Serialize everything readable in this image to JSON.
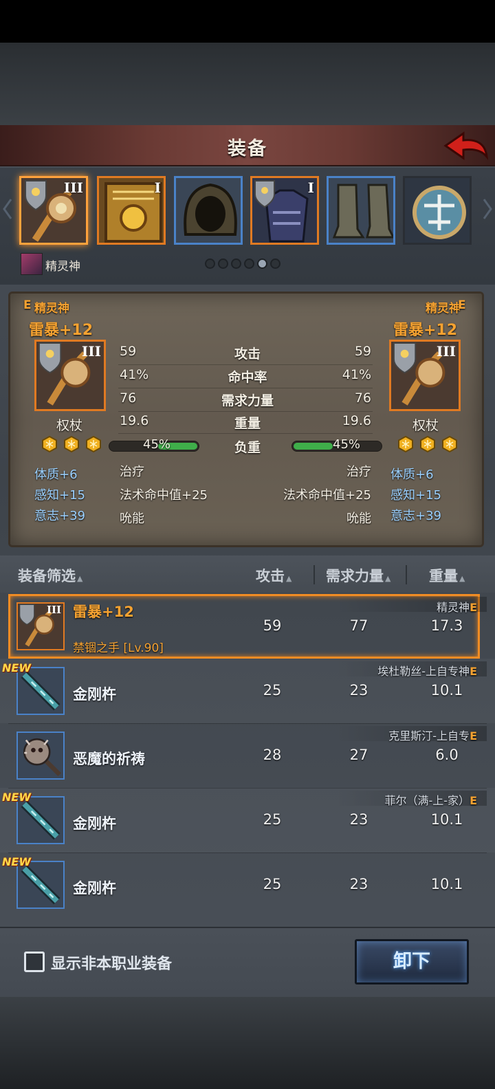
{
  "header": {
    "title": "装备"
  },
  "slots": [
    {
      "tier": "III",
      "border": "selected",
      "icon": "scepter-icon"
    },
    {
      "tier": "I",
      "border": "orange",
      "icon": "tome-icon"
    },
    {
      "tier": "",
      "border": "blue",
      "icon": "hood-icon"
    },
    {
      "tier": "I",
      "border": "orange",
      "icon": "armor-icon"
    },
    {
      "tier": "",
      "border": "blue",
      "icon": "boots-icon"
    },
    {
      "tier": "",
      "border": "plain",
      "icon": "amulet-icon"
    }
  ],
  "character": {
    "name": "精灵神"
  },
  "pager": {
    "count": 6,
    "active": 5
  },
  "compare": {
    "left": {
      "owner": "精灵神",
      "grade": "E",
      "name": "雷暴+12",
      "tier": "III",
      "type": "权杖",
      "load_pct": "45%",
      "load_value": 0.45,
      "attrs": [
        "体质+6",
        "感知+15",
        "意志+39"
      ],
      "effects": [
        "治疗",
        "法术命中值+25",
        "吮能"
      ]
    },
    "right": {
      "owner": "精灵神",
      "grade": "E",
      "name": "雷暴+12",
      "tier": "III",
      "type": "权杖",
      "load_pct": "45%",
      "load_value": 0.45,
      "attrs": [
        "体质+6",
        "感知+15",
        "意志+39"
      ],
      "effects": [
        "治疗",
        "法术命中值+25",
        "吮能"
      ]
    },
    "stats": [
      {
        "label": "攻击",
        "left": "59",
        "right": "59"
      },
      {
        "label": "命中率",
        "left": "41%",
        "right": "41%"
      },
      {
        "label": "需求力量",
        "left": "76",
        "right": "76"
      },
      {
        "label": "重量",
        "left": "19.6",
        "right": "19.6"
      }
    ],
    "load_label": "负重"
  },
  "list": {
    "headers": {
      "filter": "装备筛选",
      "attack": "攻击",
      "strength": "需求力量",
      "weight": "重量"
    },
    "items": [
      {
        "name": "雷暴+12",
        "sub": "禁锢之手 [Lv.90]",
        "owner": "精灵神",
        "grade": "E",
        "attack": "59",
        "strength": "77",
        "weight": "17.3",
        "new": "",
        "selected": true,
        "tier": "III",
        "icon": "scepter-icon"
      },
      {
        "name": "金刚杵",
        "sub": "",
        "owner": "埃杜勒丝-上自专神",
        "grade": "E",
        "attack": "25",
        "strength": "23",
        "weight": "10.1",
        "new": "NEW",
        "icon": "vajra-icon"
      },
      {
        "name": "恶魔的祈祷",
        "sub": "",
        "owner": "克里斯汀-上自专",
        "grade": "E",
        "attack": "28",
        "strength": "27",
        "weight": "6.0",
        "new": "",
        "icon": "demon-mace-icon"
      },
      {
        "name": "金刚杵",
        "sub": "",
        "owner": "菲尔（满-上-家）",
        "grade": "E",
        "attack": "25",
        "strength": "23",
        "weight": "10.1",
        "new": "NEW",
        "icon": "vajra-icon"
      },
      {
        "name": "金刚杵",
        "sub": "",
        "owner": "",
        "grade": "",
        "attack": "25",
        "strength": "23",
        "weight": "10.1",
        "new": "NEW",
        "icon": "vajra-icon"
      }
    ]
  },
  "footer": {
    "checkbox_label": "显示非本职业装备",
    "unequip_label": "卸下"
  },
  "colors": {
    "accent_orange": "#f5a231",
    "slot_blue": "#4a82c8",
    "load_green": "#3fae4a"
  }
}
